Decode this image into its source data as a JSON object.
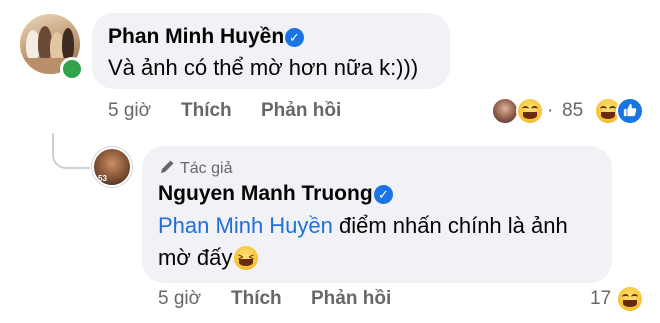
{
  "comment": {
    "author": "Phan Minh Huyền",
    "verified_icon": "verified-badge-icon",
    "text": "Và ảnh có thể mờ hơn nữa k:)))",
    "time": "5 giờ",
    "like_label": "Thích",
    "reply_label": "Phản hồi",
    "reaction_summary": {
      "separator": "·",
      "count": "85",
      "icons": [
        "profile-avatar-icon",
        "haha-reaction-icon"
      ]
    },
    "own_reactions": [
      "haha-reaction-icon",
      "like-reaction-icon"
    ],
    "online": true
  },
  "reply": {
    "badge_label": "Tác giả",
    "badge_icon": "pen-icon",
    "author": "Nguyen Manh Truong",
    "verified_icon": "verified-badge-icon",
    "mention": "Phan Minh Huyền",
    "text_after_mention": " điểm nhấn chính là ảnh",
    "text_line2": "mờ đấy",
    "emoji_icon": "laughing-squint-emoji-icon",
    "avatar_number": "53",
    "time": "5 giờ",
    "like_label": "Thích",
    "reply_label": "Phản hồi",
    "reaction_count": "17",
    "reaction_icon": "haha-reaction-icon"
  },
  "colors": {
    "bubble": "#f0f2f5",
    "meta_text": "#65676b",
    "link": "#216fdb",
    "verified": "#1b74e4",
    "online": "#31a24c"
  }
}
